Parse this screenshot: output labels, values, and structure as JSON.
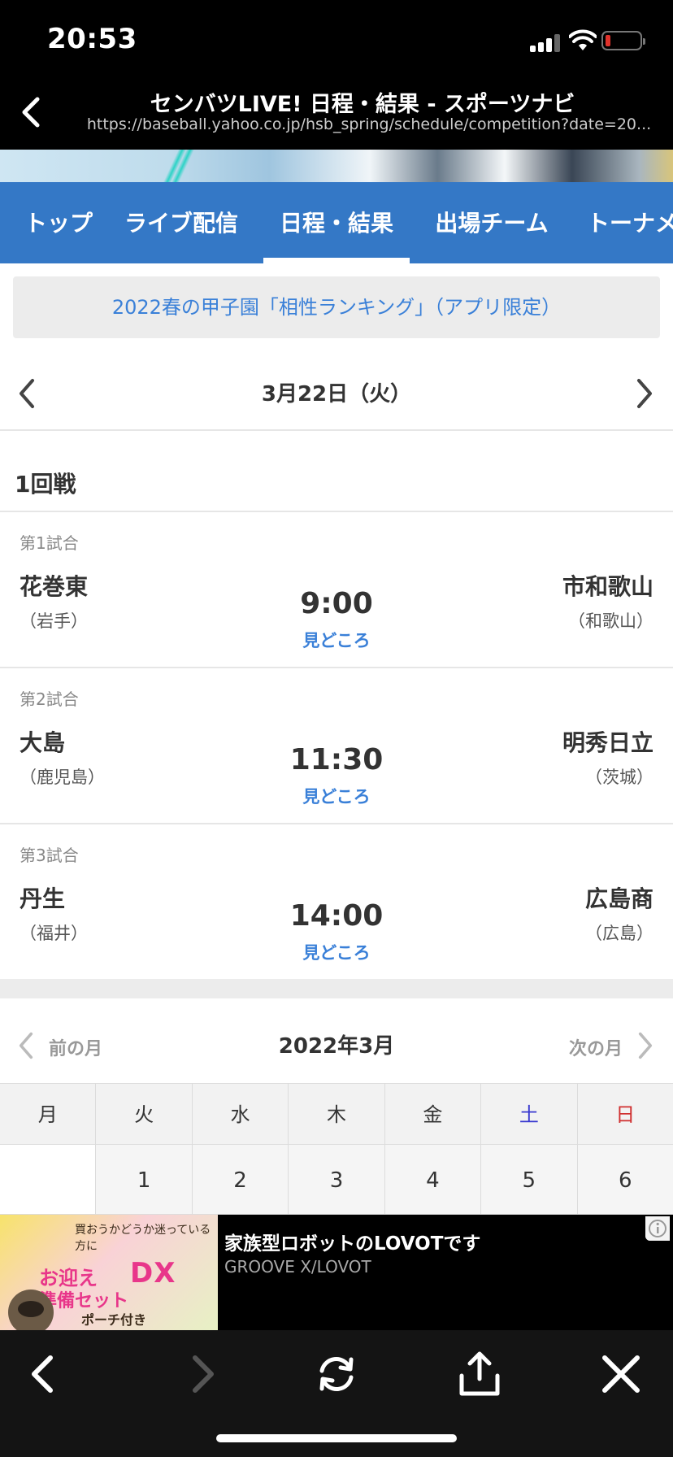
{
  "status": {
    "time": "20:53"
  },
  "navbar": {
    "title": "センバツLIVE! 日程・結果 - スポーツナビ",
    "url": "https://baseball.yahoo.co.jp/hsb_spring/schedule/competition?date=20..."
  },
  "tabs": [
    {
      "label": "トップ"
    },
    {
      "label": "ライブ配信"
    },
    {
      "label": "日程・結果",
      "active": true
    },
    {
      "label": "出場チーム"
    },
    {
      "label": "トーナメ"
    }
  ],
  "promo": {
    "text": "2022春の甲子園「相性ランキング」（アプリ限定）"
  },
  "date": {
    "label": "3月22日（火）"
  },
  "round": {
    "label": "1回戦"
  },
  "games": [
    {
      "number": "第1試合",
      "home": "花巻東",
      "home_pref": "（岩手）",
      "time": "9:00",
      "link": "見どころ",
      "away": "市和歌山",
      "away_pref": "（和歌山）"
    },
    {
      "number": "第2試合",
      "home": "大島",
      "home_pref": "（鹿児島）",
      "time": "11:30",
      "link": "見どころ",
      "away": "明秀日立",
      "away_pref": "（茨城）"
    },
    {
      "number": "第3試合",
      "home": "丹生",
      "home_pref": "（福井）",
      "time": "14:00",
      "link": "見どころ",
      "away": "広島商",
      "away_pref": "（広島）"
    }
  ],
  "calendar": {
    "prev": "前の月",
    "title": "2022年3月",
    "next": "次の月",
    "weekdays": [
      "月",
      "火",
      "水",
      "木",
      "金",
      "土",
      "日"
    ],
    "first_week": [
      "",
      "1",
      "2",
      "3",
      "4",
      "5",
      "6"
    ],
    "colors": {
      "saturday": "#3a3ad0",
      "sunday": "#d03030"
    }
  },
  "ad": {
    "title": "家族型ロボットのLOVOTです",
    "advertiser": "GROOVE X/LOVOT",
    "image_text": {
      "line1": "買おうかどうか迷っている方に",
      "line2": "お迎え",
      "line3": "準備セット",
      "dx": "DX",
      "line4": "ポーチ付き"
    }
  },
  "colors": {
    "tab_bg": "#3478c6",
    "link": "#3a80d8"
  }
}
